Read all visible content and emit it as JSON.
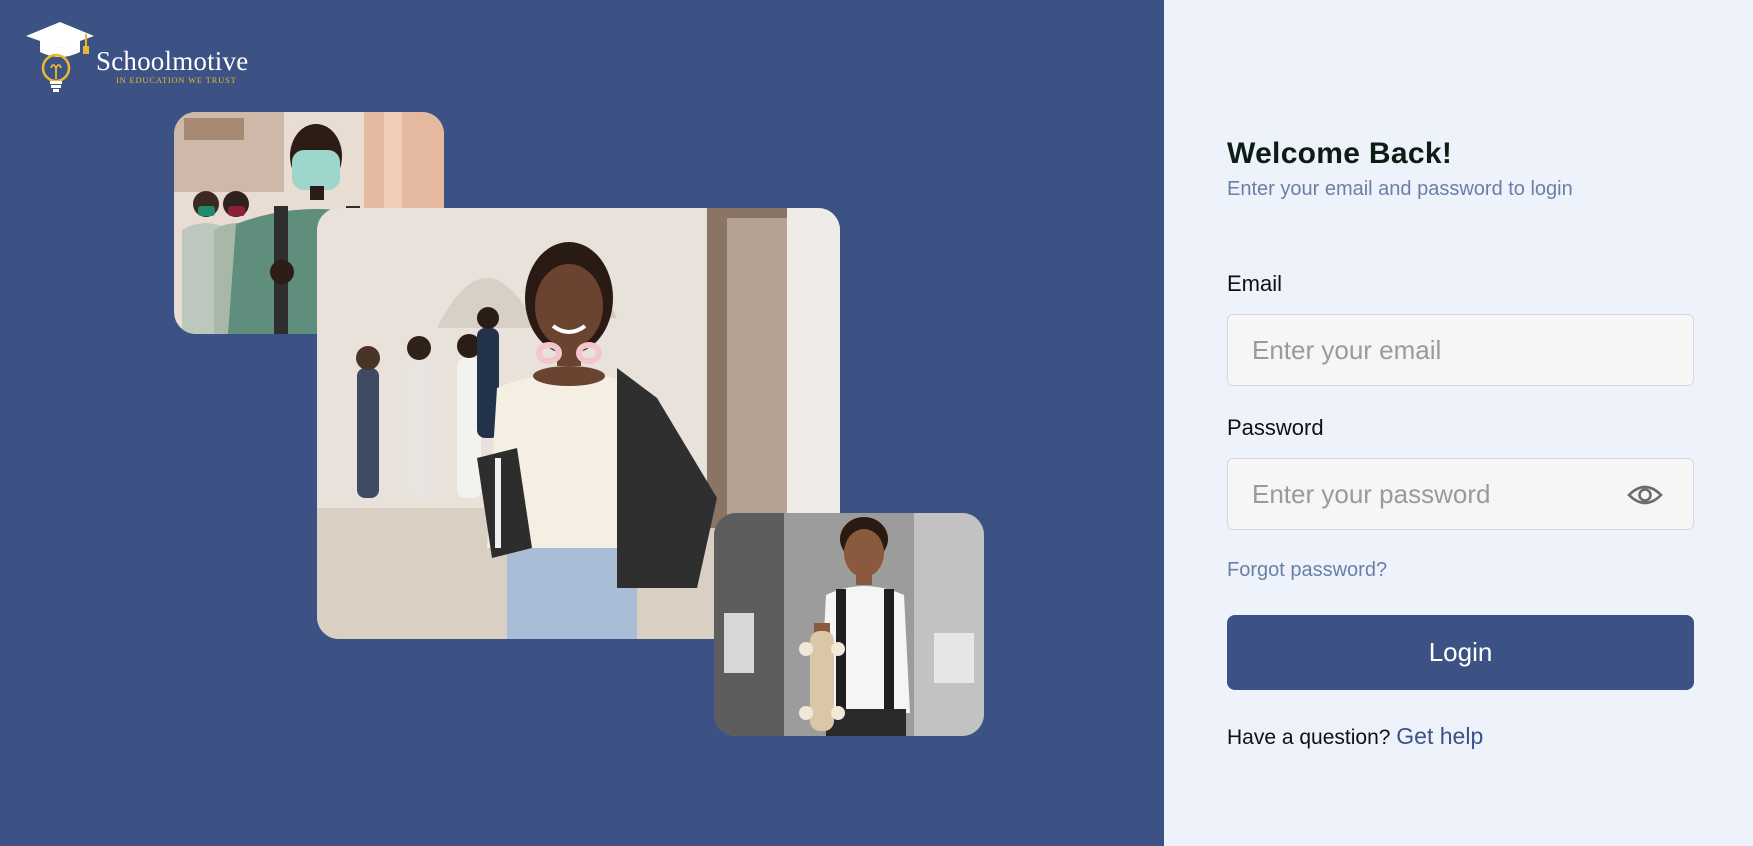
{
  "brand": {
    "name": "Schoolmotive",
    "tagline": "IN EDUCATION WE TRUST",
    "primary_color": "#3c5285",
    "accent_color": "#e8b82d"
  },
  "left_panel": {
    "background": "#3c5285",
    "photos": [
      {
        "name": "students-masks-photo"
      },
      {
        "name": "student-hallway-photo"
      },
      {
        "name": "boy-skateboard-photo"
      }
    ]
  },
  "login": {
    "title": "Welcome Back!",
    "subtitle": "Enter your email and password to login",
    "email_label": "Email",
    "email_placeholder": "Enter your email",
    "email_value": "",
    "password_label": "Password",
    "password_placeholder": "Enter your password",
    "password_value": "",
    "password_toggle_icon": "eye-icon",
    "forgot_password": "Forgot password?",
    "login_button": "Login",
    "help_prompt": "Have a question?",
    "help_link": "Get help"
  }
}
